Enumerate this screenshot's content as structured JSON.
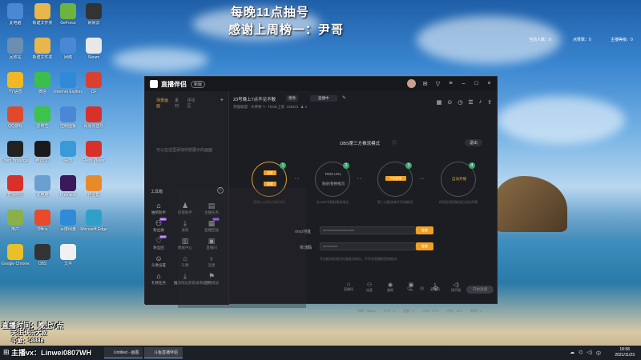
{
  "overlay": {
    "line1": "每晚11点抽号",
    "line2": "感谢上周榜一：尹哥"
  },
  "stats": {
    "left": "当前人数：0",
    "mid": "点赞数：0",
    "right": "主播等级：0"
  },
  "desktop_icons": [
    {
      "label": "此电脑",
      "color": "#4a88d6"
    },
    {
      "label": "新建文件夹",
      "color": "#e8b64a"
    },
    {
      "label": "GeForce",
      "color": "#6db33f"
    },
    {
      "label": "网易云",
      "color": "#333"
    },
    {
      "label": "回收站",
      "color": "#6a8fb0"
    },
    {
      "label": "新建文件夹",
      "color": "#e8b64a"
    },
    {
      "label": "网络",
      "color": "#4a88d6"
    },
    {
      "label": "Steam",
      "color": "#e8e8e8"
    },
    {
      "label": "YY语音",
      "color": "#f2b824"
    },
    {
      "label": "微信",
      "color": "#3bbf4a"
    },
    {
      "label": "Internet Explorer",
      "color": "#2f8ad8"
    },
    {
      "label": "CF",
      "color": "#d8412f"
    },
    {
      "label": "QQ游戏",
      "color": "#e04a2a"
    },
    {
      "label": "爱奇艺",
      "color": "#3dc24a"
    },
    {
      "label": "控制面板",
      "color": "#4a88d6"
    },
    {
      "label": "网易云音乐",
      "color": "#d8312a"
    },
    {
      "label": "Open Broadcaster",
      "color": "#222"
    },
    {
      "label": "腾讯QQ",
      "color": "#1a1a1a"
    },
    {
      "label": "桌面",
      "color": "#3a9ad8"
    },
    {
      "label": "Flash Player",
      "color": "#d8312a"
    },
    {
      "label": "直播伴侣",
      "color": "#d8312a"
    },
    {
      "label": "此电脑",
      "color": "#6aa0d0"
    },
    {
      "label": "Premiere",
      "color": "#3a1a5a"
    },
    {
      "label": "作业帮",
      "color": "#e88a2a"
    },
    {
      "label": "用户",
      "color": "#8ab04a"
    },
    {
      "label": "Office",
      "color": "#e84a2a"
    },
    {
      "label": "百度网盘",
      "color": "#2f8ad8"
    },
    {
      "label": "Microsoft Edge",
      "color": "#2fa0c8"
    },
    {
      "label": "Google Chrome",
      "color": "#e8c02a"
    },
    {
      "label": "OBS",
      "color": "#333"
    },
    {
      "label": "文件",
      "color": "#f0f0f0"
    }
  ],
  "window": {
    "logo": "直播伴侣",
    "version": "新版",
    "controls": [
      "消息",
      "皮肤",
      "更多",
      "最小化",
      "最大化",
      "关闭"
    ]
  },
  "left_panel": {
    "tabs": [
      "场景画面",
      "素材",
      "评论区"
    ],
    "add": "+",
    "empty_tip": "可以在这里添加你想展示的画面"
  },
  "tools": {
    "title": "工具箱",
    "close": "×",
    "items": [
      {
        "label": "抽奖助手",
        "icon": "gift-icon"
      },
      {
        "label": "房管助手",
        "icon": "user-icon"
      },
      {
        "label": "主播任务",
        "icon": "task-icon"
      },
      {
        "label": "粉丝群",
        "icon": "group-icon",
        "new": "NEW"
      },
      {
        "label": "录屏",
        "icon": "download-icon"
      },
      {
        "label": "直播回放",
        "icon": "replay-icon",
        "new": "NEW"
      },
      {
        "label": "粉丝团",
        "icon": "fans-icon",
        "new": "NEW"
      },
      {
        "label": "数据中心",
        "icon": "data-icon"
      },
      {
        "label": "直播间",
        "icon": "room-icon"
      },
      {
        "label": "头像设置",
        "icon": "avatar-icon"
      },
      {
        "label": "礼物",
        "icon": "gift-icon"
      },
      {
        "label": "连麦",
        "icon": "mic-icon"
      },
      {
        "label": "礼物任务",
        "icon": "gift-icon"
      },
      {
        "label": "推流地址获取录像助手",
        "icon": "download-icon"
      },
      {
        "label": "直播挑战",
        "icon": "challenge-icon"
      }
    ]
  },
  "room": {
    "title": "23号晚上7点不见不散",
    "change_btn": "更改",
    "live_type": "直播中",
    "meta_category": "英雄联盟 · 大神秀",
    "meta_user": "Theliz上架",
    "meta_id": "105441",
    "meta_count": "4"
  },
  "mode": {
    "title": "OBS第三方推流模式",
    "exit": "退出",
    "steps": [
      {
        "num": "1",
        "label": "",
        "btn1": "复制",
        "btn2": "复制",
        "desc": "复制rtmp地址和推流码"
      },
      {
        "num": "2",
        "label": "RMS URL",
        "sub": "粘贴/替换推流",
        "desc": "在OBS中粘贴推流地址"
      },
      {
        "num": "3",
        "label": "",
        "btn1": "开启直播",
        "desc": "第三方推流软件开始推流"
      },
      {
        "num": "4",
        "label": "",
        "sub": "自动开播",
        "desc": "伴侣检测到推流后自动开播"
      }
    ]
  },
  "fields": {
    "rtmp_label": "rtmp地址",
    "rtmp_value": "••••••••••••••••••••••••••••",
    "key_label": "推流码",
    "key_value": "•••••••••••••",
    "copy": "复制",
    "hint": "开启推流前请先检查推流地址，不开启直播前直接推流"
  },
  "bottom": {
    "items": [
      "直播间",
      "连麦",
      "美颜",
      "PK",
      "麦克风",
      "扬声器"
    ],
    "start": "开始直播"
  },
  "status": [
    "码率：0kbps",
    "FPS：0",
    "丢帧：0",
    "CPU：27%",
    "内存：21%",
    "帧率：0"
  ],
  "watermark": {
    "line1": "直播时间：晚上7点",
    "line2": "关注·快乐大叔",
    "line3": "斗鱼：18888",
    "line4": "主播vx：Linwei0807WH"
  },
  "taskbar": {
    "apps": [
      "Untitled - 画图",
      "斗鱼直播伴侣"
    ],
    "time": "18:58",
    "date": "2021/11/23"
  }
}
